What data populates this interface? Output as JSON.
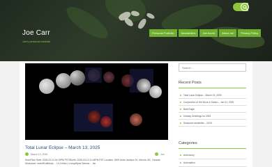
{
  "site": {
    "title": "Joe Carr",
    "tagline": "Joe's personal website"
  },
  "nav": {
    "items": [
      {
        "label": "Personal Portfolio"
      },
      {
        "label": "Newsletters"
      },
      {
        "label": "Joe found"
      },
      {
        "label": "About me"
      },
      {
        "label": "Privacy Policy"
      }
    ]
  },
  "topbar": {
    "search_icon": "search-icon"
  },
  "post": {
    "title": "Total Lunar Eclipse – March 13, 2025",
    "date": "March 13, 2025",
    "author": "Joe",
    "excerpt": "SmerTime Start: 2025-03-13 24:19PM PST/Rueth: 2025-03-13 11:44PM PST Location: 3000 block Jackson St. Victoria, BC, Canada Disclosure: rearriffCalifotoia ... 14.2 bitsx1 4 coupWpnz Deimos ... Isn"
  },
  "sidebar": {
    "search_placeholder": "Search ...",
    "recent_title": "Recent Posts",
    "recent_posts": [
      "Total Lunar Eclipse – March 13, 2025",
      "Conjunction of the Moon & Saturn – Jan 31, 2025",
      "Bald Eagle",
      "Holiday Greetings for 2025",
      "Seasonal newsletter – 2025"
    ],
    "categories_title": "Categories",
    "categories": [
      "Astronomy",
      "Automation"
    ]
  },
  "colors": {
    "accent": "#8cc63f",
    "nav": "#6fae2f",
    "title_link": "#2f4a7a"
  }
}
